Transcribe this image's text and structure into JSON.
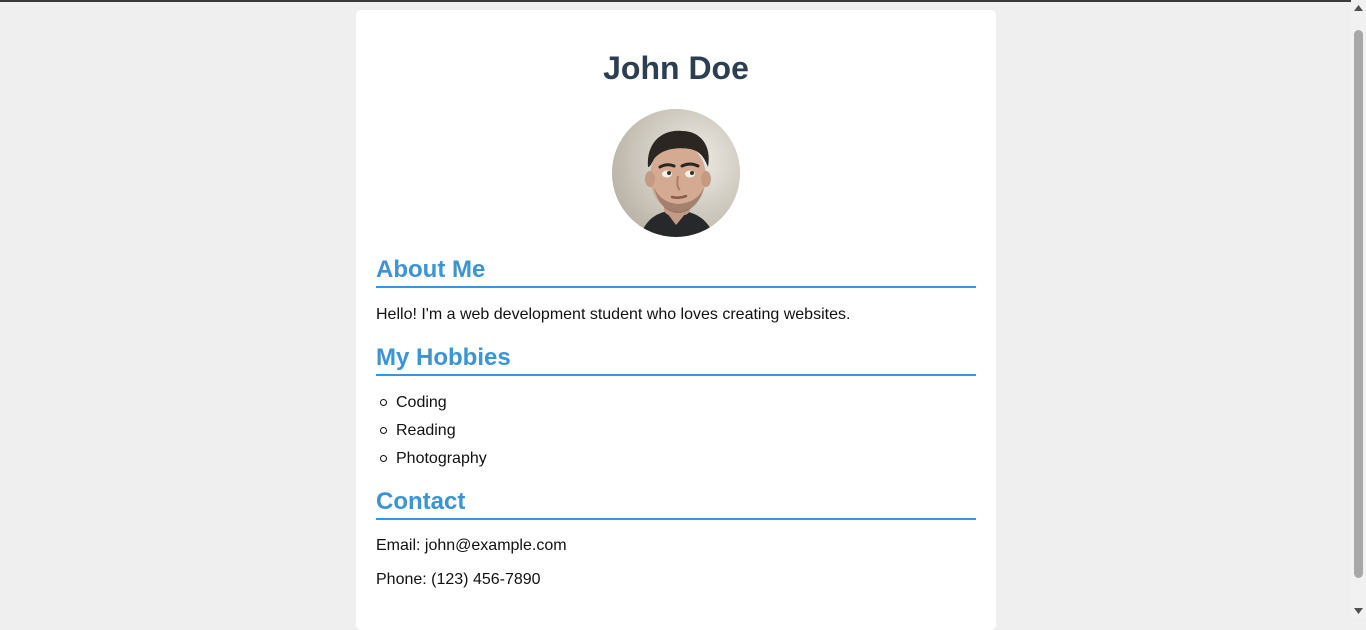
{
  "profile": {
    "name": "John Doe"
  },
  "about": {
    "title": "About Me",
    "text": "Hello! I'm a web development student who loves creating websites."
  },
  "hobbies": {
    "title": "My Hobbies",
    "items": [
      {
        "label": "Coding"
      },
      {
        "label": "Reading"
      },
      {
        "label": "Photography"
      }
    ]
  },
  "contact": {
    "title": "Contact",
    "email": "Email: john@example.com",
    "phone": "Phone: (123) 456-7890"
  },
  "colors": {
    "page_bg": "#efefef",
    "card_bg": "#ffffff",
    "heading": "#2c3e50",
    "accent": "#3a94d6"
  },
  "icons": {
    "list_bullet": "circle-bullet-icon",
    "scroll_up": "chevron-up-icon",
    "scroll_down": "chevron-down-icon"
  }
}
